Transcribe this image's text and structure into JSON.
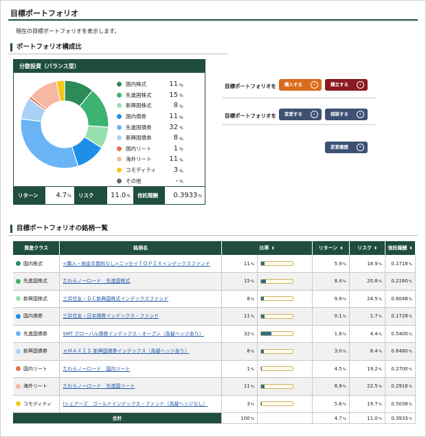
{
  "page": {
    "title": "目標ポートフォリオ",
    "intro": "現在の目標ポートフォリオを表示します。"
  },
  "composition": {
    "title": "ポートフォリオ構成比",
    "card_title": "分散投資（バランス型）",
    "stats": {
      "return_label": "リターン",
      "return_value": "4.7",
      "risk_label": "リスク",
      "risk_value": "11.0",
      "fee_label": "信託報酬",
      "fee_value": "0.3933"
    }
  },
  "chart_data": {
    "type": "pie",
    "categories": [
      "国内株式",
      "先進国株式",
      "新興国株式",
      "国内債券",
      "先進国債券",
      "新興国債券",
      "国内リート",
      "海外リート",
      "コモディティ",
      "その他"
    ],
    "values": [
      11,
      15,
      8,
      11,
      32,
      8,
      1,
      11,
      3,
      0
    ],
    "labels": [
      "11",
      "15",
      "8",
      "11",
      "32",
      "8",
      "1",
      "11",
      "3",
      "-"
    ],
    "colors": [
      "#2e8b57",
      "#3cb371",
      "#98dfb0",
      "#1e8fe6",
      "#6ab4f5",
      "#a9d0f7",
      "#e8704e",
      "#f7b8a2",
      "#f5c518",
      "#666666"
    ]
  },
  "actions": {
    "row1_label": "目標ポートフォリオを",
    "purchase": "購入する",
    "accumulate": "積立する",
    "row2_label": "目標ポートフォリオを",
    "change": "変更する",
    "consult": "相談する",
    "history": "変更履歴"
  },
  "holdings": {
    "title": "目標ポートフォリオの銘柄一覧",
    "headers": [
      "資産クラス",
      "銘柄名",
      "比率",
      "リターン",
      "リスク",
      "信託報酬"
    ],
    "rows": [
      {
        "class": "国内株式",
        "color": "#2e8b57",
        "fund": "<購入・換金手数料なし>ニッセイＴＯＰＩＸインデックスファンド",
        "ratio": 11,
        "ret": "5.9",
        "risk": "18.9",
        "fee": "0.1718"
      },
      {
        "class": "先進国株式",
        "color": "#3cb371",
        "fund": "たわらノーロード　先進国株式",
        "ratio": 15,
        "ret": "8.4",
        "risk": "20.8",
        "fee": "0.2160"
      },
      {
        "class": "新興国株式",
        "color": "#98dfb0",
        "fund": "三井住友・ＤＣ新興国株式インデックスファンド",
        "ratio": 8,
        "ret": "9.9",
        "risk": "24.5",
        "fee": "0.6048"
      },
      {
        "class": "国内債券",
        "color": "#1e8fe6",
        "fund": "三井住友・日本債券インデックス・ファンド",
        "ratio": 11,
        "ret": "0.1",
        "risk": "1.7",
        "fee": "0.1728"
      },
      {
        "class": "先進国債券",
        "color": "#6ab4f5",
        "fund": "SMT グローバル債券インデックス・オープン（為替ヘッジあり）",
        "ratio": 32,
        "ret": "1.8",
        "risk": "4.4",
        "fee": "0.5400"
      },
      {
        "class": "新興国債券",
        "color": "#a9d0f7",
        "fund": "ｅＭＡＸＩＳ 新興国債券インデックス（為替ヘッジあり）",
        "ratio": 8,
        "ret": "3.0",
        "risk": "8.4",
        "fee": "0.6480"
      },
      {
        "class": "国内リート",
        "color": "#e8704e",
        "fund": "たわらノーロード　国内リート",
        "ratio": 1,
        "ret": "4.5",
        "risk": "19.2",
        "fee": "0.2700"
      },
      {
        "class": "海外リート",
        "color": "#f7b8a2",
        "fund": "たわらノーロード　先進国リート",
        "ratio": 11,
        "ret": "8.9",
        "risk": "22.5",
        "fee": "0.2916"
      },
      {
        "class": "コモディティ",
        "color": "#f5c518",
        "fund": "iシェアーズ　ゴールドインデックス・ファンド（為替ヘッジなし）",
        "ratio": 3,
        "ret": "5.6",
        "risk": "19.7",
        "fee": "0.5038"
      }
    ],
    "total": {
      "label": "合計",
      "ratio": "100",
      "ret": "4.7",
      "risk": "11.0",
      "fee": "0.3933"
    }
  }
}
